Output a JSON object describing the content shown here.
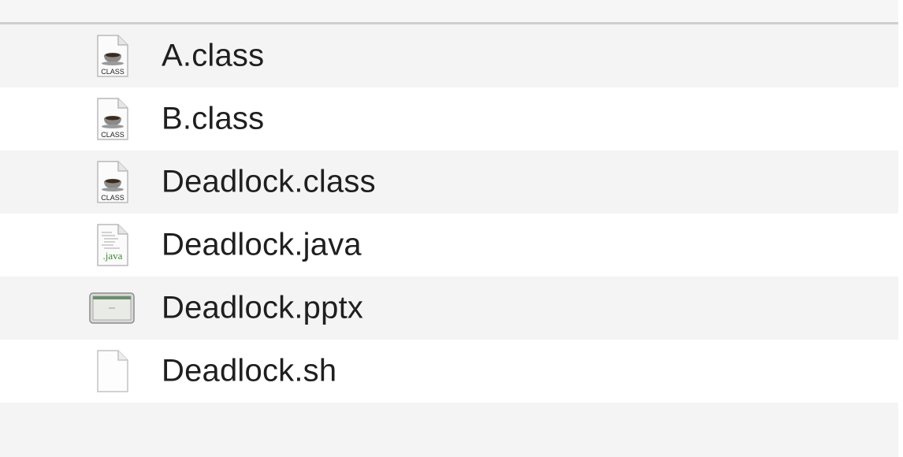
{
  "files": [
    {
      "name": "A.class",
      "icon": "java-class-icon",
      "icon_label": "CLASS"
    },
    {
      "name": "B.class",
      "icon": "java-class-icon",
      "icon_label": "CLASS"
    },
    {
      "name": "Deadlock.class",
      "icon": "java-class-icon",
      "icon_label": "CLASS"
    },
    {
      "name": "Deadlock.java",
      "icon": "java-source-icon",
      "icon_label": ".java"
    },
    {
      "name": "Deadlock.pptx",
      "icon": "presentation-icon",
      "icon_label": ""
    },
    {
      "name": "Deadlock.sh",
      "icon": "blank-document-icon",
      "icon_label": ""
    }
  ],
  "colors": {
    "row_alt": "#f4f4f5",
    "row_base": "#ffffff",
    "text": "#1f1f1f",
    "java_green": "#3a8a2e"
  }
}
